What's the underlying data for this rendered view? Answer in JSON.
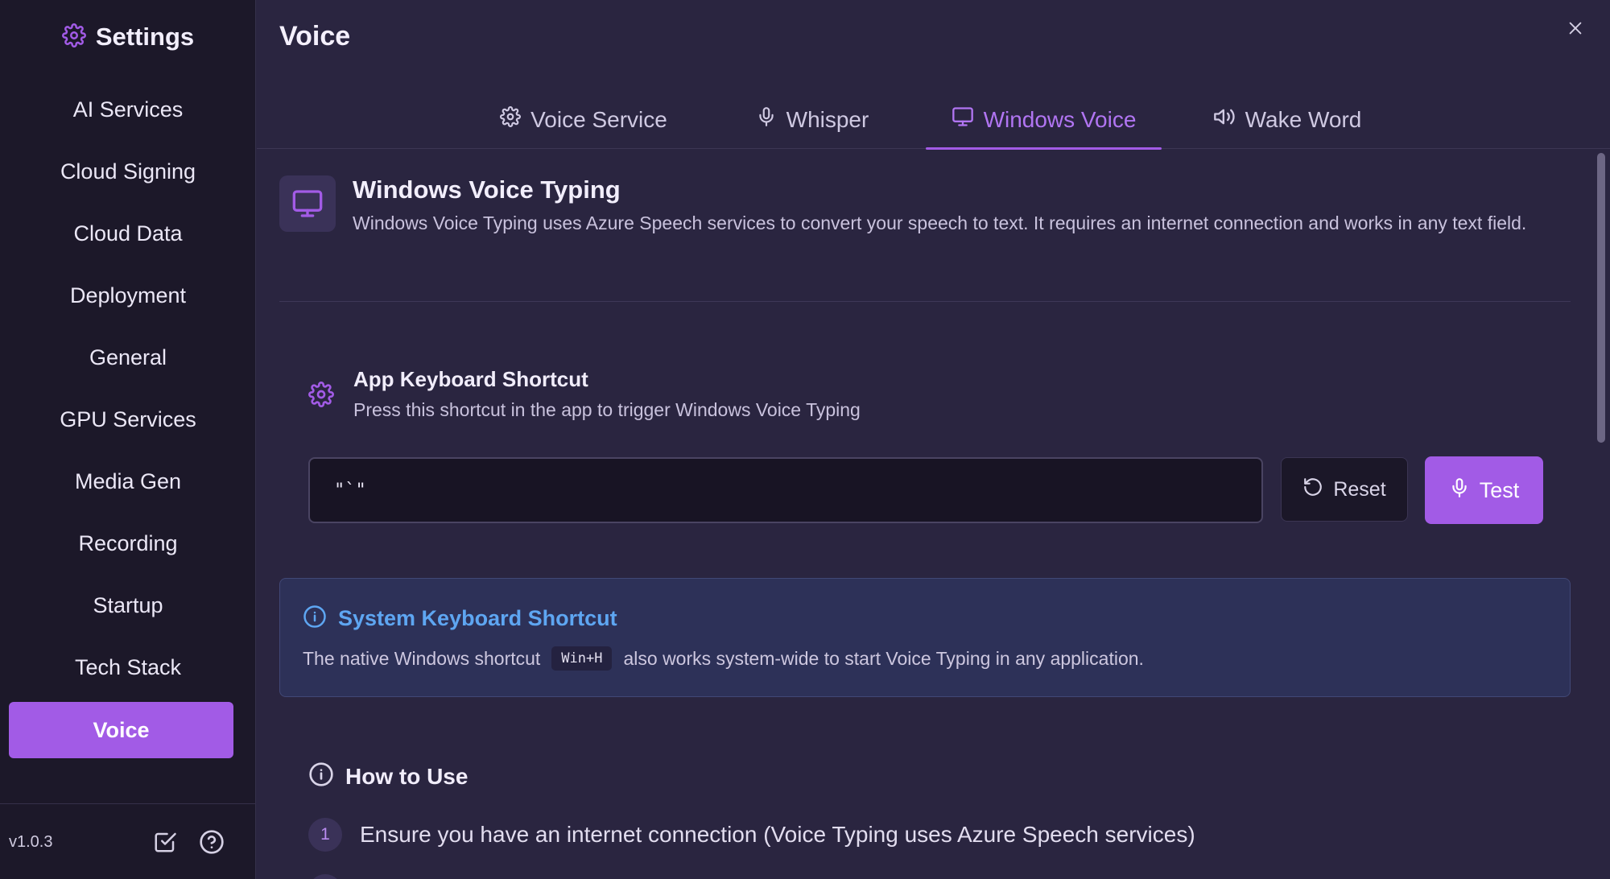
{
  "sidebar": {
    "title": "Settings",
    "items": [
      {
        "label": "AI Services"
      },
      {
        "label": "Cloud Signing"
      },
      {
        "label": "Cloud Data"
      },
      {
        "label": "Deployment"
      },
      {
        "label": "General"
      },
      {
        "label": "GPU Services"
      },
      {
        "label": "Media Gen"
      },
      {
        "label": "Recording"
      },
      {
        "label": "Startup"
      },
      {
        "label": "Tech Stack"
      },
      {
        "label": "Voice"
      }
    ],
    "active_index": 10,
    "version": "v1.0.3"
  },
  "header": {
    "title": "Voice"
  },
  "tabs": [
    {
      "label": "Voice Service",
      "icon": "gear-icon"
    },
    {
      "label": "Whisper",
      "icon": "microphone-icon"
    },
    {
      "label": "Windows Voice",
      "icon": "monitor-icon"
    },
    {
      "label": "Wake Word",
      "icon": "speaker-icon"
    }
  ],
  "active_tab": 2,
  "hero": {
    "title": "Windows Voice Typing",
    "description": "Windows Voice Typing uses Azure Speech services to convert your speech to text. It requires an internet connection and works in any text field."
  },
  "app_shortcut": {
    "title": "App Keyboard Shortcut",
    "description": "Press this shortcut in the app to trigger Windows Voice Typing",
    "value": "\"`\"",
    "reset_label": "Reset",
    "test_label": "Test"
  },
  "system_shortcut": {
    "title": "System Keyboard Shortcut",
    "text_before": "The native Windows shortcut",
    "key": "Win+H",
    "text_after": "also works system-wide to start Voice Typing in any application."
  },
  "how_to": {
    "title": "How to Use",
    "steps": [
      {
        "number": "1",
        "text": "Ensure you have an internet connection (Voice Typing uses Azure Speech services)"
      }
    ]
  },
  "colors": {
    "accent": "#a25be6",
    "info": "#5ea6f2",
    "sidebar_bg": "#1c1829",
    "main_bg": "#2a2540"
  }
}
